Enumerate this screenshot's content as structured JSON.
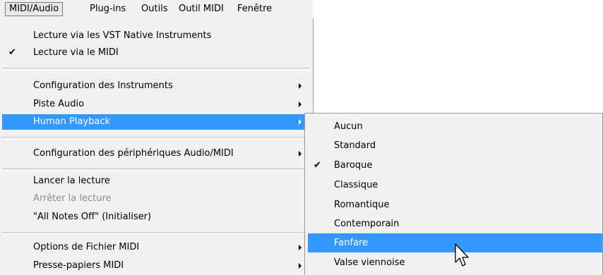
{
  "menubar": {
    "items": [
      "MIDI/Audio",
      "Plug-ins",
      "Outils",
      "Outil MIDI",
      "Fenêtre"
    ]
  },
  "main_menu": {
    "items": [
      {
        "label": "Lecture via les VST Native Instruments"
      },
      {
        "label": "Lecture via le MIDI",
        "checked": true
      },
      {
        "label": "Configuration des Instruments",
        "submenu": true
      },
      {
        "label": "Piste Audio",
        "submenu": true
      },
      {
        "label": "Human Playback",
        "submenu": true,
        "highlighted": true
      },
      {
        "label": "Configuration des périphériques Audio/MIDI",
        "submenu": true
      },
      {
        "label": "Lancer la lecture"
      },
      {
        "label": "Arrêter la lecture",
        "disabled": true
      },
      {
        "label": "\"All Notes Off\" (Initialiser)"
      },
      {
        "label": "Options de Fichier MIDI",
        "submenu": true
      },
      {
        "label": "Presse-papiers MIDI",
        "submenu": true
      }
    ],
    "check_glyph": "✔"
  },
  "sub_menu": {
    "items": [
      {
        "label": "Aucun"
      },
      {
        "label": "Standard"
      },
      {
        "label": "Baroque",
        "checked": true
      },
      {
        "label": "Classique"
      },
      {
        "label": "Romantique"
      },
      {
        "label": "Contemporain"
      },
      {
        "label": "Fanfare",
        "highlighted": true
      },
      {
        "label": "Valse viennoise"
      }
    ],
    "check_glyph": "✔"
  },
  "colors": {
    "highlight": "#3399ff",
    "menu_bg": "#f1f1f1",
    "disabled_text": "#8d8d8d"
  },
  "icons": {
    "cursor": "arrow-pointer-icon"
  }
}
